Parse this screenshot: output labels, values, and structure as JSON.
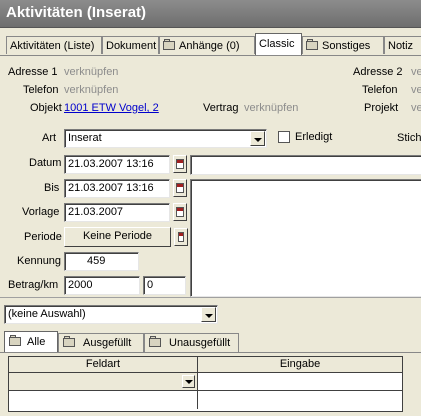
{
  "window": {
    "title": "Aktivitäten (Inserat)"
  },
  "tabs": [
    {
      "label": "Aktivitäten (Liste)",
      "icon": ""
    },
    {
      "label": "Dokument",
      "icon": ""
    },
    {
      "label": "Anhänge (0)",
      "icon": "folder-icon"
    },
    {
      "label": "Classic",
      "icon": ""
    },
    {
      "label": "Sonstiges",
      "icon": "folder-icon"
    },
    {
      "label": "Notiz",
      "icon": ""
    }
  ],
  "contact": {
    "adresse1_label": "Adresse 1",
    "adresse1_value": "verknüpfen",
    "telefon1_label": "Telefon",
    "telefon1_value": "verknüpfen",
    "objekt_label": "Objekt",
    "objekt_value": "1001 ETW Vogel, 2",
    "vertrag_label": "Vertrag",
    "vertrag_value": "verknüpfen",
    "adresse2_label": "Adresse 2",
    "adresse2_value": "ve",
    "telefon2_label": "Telefon",
    "telefon2_value": "ve",
    "projekt_label": "Projekt",
    "projekt_value": "ve"
  },
  "form": {
    "art_label": "Art",
    "art_value": "Inserat",
    "erledigt_label": "Erledigt",
    "stich_label": "Stich",
    "datum_label": "Datum",
    "datum_value": "21.03.2007 13:16",
    "bis_label": "Bis",
    "bis_value": "21.03.2007 13:16",
    "vorlage_label": "Vorlage",
    "vorlage_value": "21.03.2007",
    "periode_label": "Periode",
    "periode_button": "Keine Periode",
    "kennung_label": "Kennung",
    "kennung_value": "459",
    "betrag_label": "Betrag/km",
    "betrag_value": "2000",
    "km_value": "0"
  },
  "selection": {
    "value": "(keine Auswahl)"
  },
  "lower_tabs": [
    {
      "label": "Alle",
      "icon": "folder-icon"
    },
    {
      "label": "Ausgefüllt",
      "icon": "folder-icon"
    },
    {
      "label": "Unausgefüllt",
      "icon": "folder-icon"
    }
  ],
  "grid": {
    "columns": [
      "Feldart",
      "Eingabe"
    ],
    "rows": [
      {
        "feldart": "",
        "eingabe": ""
      },
      {
        "feldart": "",
        "eingabe": ""
      }
    ]
  }
}
